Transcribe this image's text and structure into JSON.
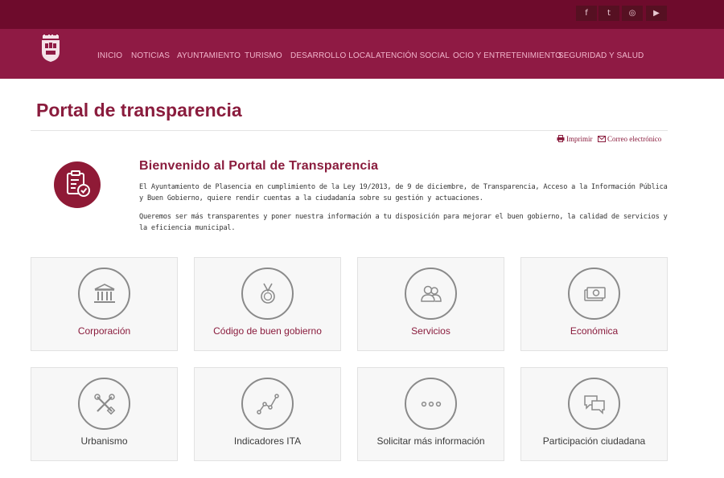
{
  "social": [
    {
      "label": "f",
      "icon": "facebook-icon"
    },
    {
      "label": "t",
      "icon": "twitter-icon"
    },
    {
      "label": "◎",
      "icon": "instagram-icon"
    },
    {
      "label": "▶",
      "icon": "youtube-icon"
    }
  ],
  "nav": [
    {
      "label": "INICIO"
    },
    {
      "label": "NOTICIAS"
    },
    {
      "label": "AYUNTAMIENTO"
    },
    {
      "label": "TURISMO"
    },
    {
      "label": "DESARROLLO LOCAL"
    },
    {
      "label": "ATENCIÓN SOCIAL"
    },
    {
      "label": "OCIO Y ENTRETENIMIENTO"
    },
    {
      "label": "SEGURIDAD Y SALUD"
    }
  ],
  "page_title": "Portal de transparencia",
  "tools": {
    "print": "Imprimir",
    "email": "Correo electrónico"
  },
  "intro": {
    "title": "Bienvenido al Portal de Transparencia",
    "p1": "El Ayuntamiento de Plasencia en cumplimiento de la Ley 19/2013, de 9 de diciembre, de Transparencia, Acceso a la Información Pública y Buen Gobierno, quiere rendir cuentas a la ciudadanía sobre su gestión y actuaciones.",
    "p2": "Queremos ser más transparentes y poner nuestra información a tu disposición para mejorar el buen gobierno, la calidad de servicios y la eficiencia municipal."
  },
  "cards": [
    {
      "label": "Corporación",
      "icon": "institution-icon"
    },
    {
      "label": "Código de buen gobierno",
      "icon": "medal-icon"
    },
    {
      "label": "Servicios",
      "icon": "people-icon"
    },
    {
      "label": "Económica",
      "icon": "money-icon"
    },
    {
      "label": "Urbanismo",
      "icon": "tools-icon"
    },
    {
      "label": "Indicadores ITA",
      "icon": "line-chart-icon"
    },
    {
      "label": "Solicitar más información",
      "icon": "more-icon"
    },
    {
      "label": "Participación ciudadana",
      "icon": "chat-icon"
    }
  ],
  "colors": {
    "brand": "#8f1a44",
    "brand_dark": "#6e0b2c",
    "accent_text": "#8a1c3d"
  }
}
